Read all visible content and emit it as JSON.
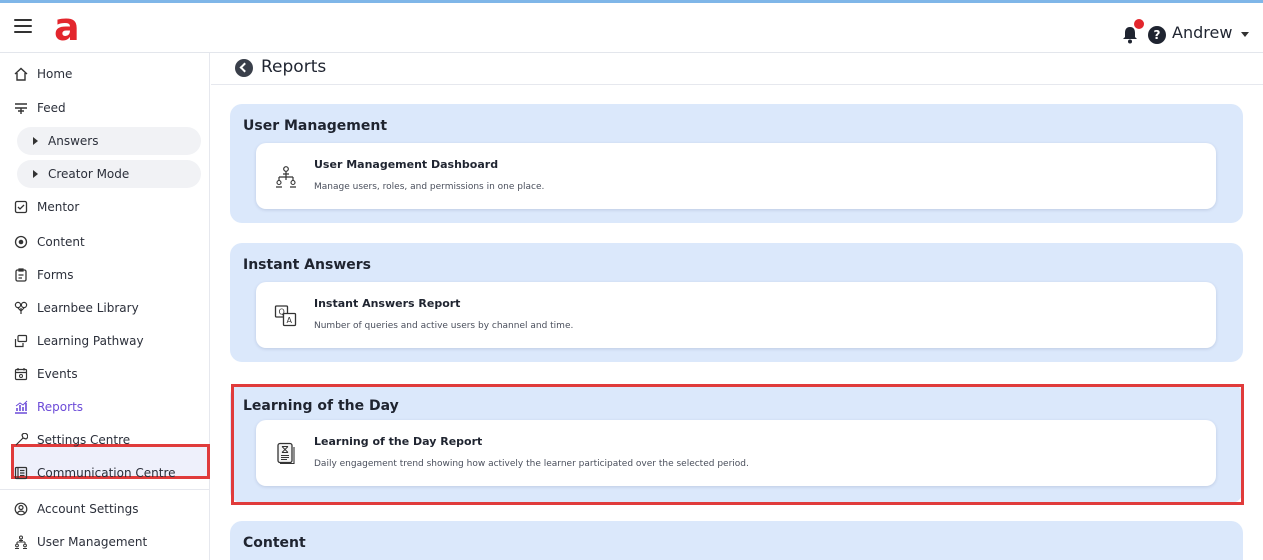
{
  "header": {
    "logo": "a",
    "user_name": "Andrew"
  },
  "sidebar": {
    "items": [
      {
        "label": "Home",
        "icon": "home-icon"
      },
      {
        "label": "Feed",
        "icon": "feed-icon"
      },
      {
        "label": "Answers",
        "sub": true
      },
      {
        "label": "Creator Mode",
        "sub": true
      },
      {
        "label": "Mentor",
        "icon": "mentor-icon"
      },
      {
        "label": "Content",
        "icon": "content-icon"
      },
      {
        "label": "Forms",
        "icon": "forms-icon"
      },
      {
        "label": "Learnbee Library",
        "icon": "library-icon"
      },
      {
        "label": "Learning Pathway",
        "icon": "pathway-icon"
      },
      {
        "label": "Events",
        "icon": "calendar-icon"
      },
      {
        "label": "Reports",
        "icon": "reports-icon",
        "active": true
      },
      {
        "label": "Settings Centre",
        "icon": "settings-icon"
      },
      {
        "label": "Communication Centre",
        "icon": "communication-icon"
      },
      {
        "label": "Account Settings",
        "icon": "account-icon"
      },
      {
        "label": "User Management",
        "icon": "users-icon"
      }
    ]
  },
  "main": {
    "page_title": "Reports",
    "sections": [
      {
        "title": "User Management",
        "card": {
          "title": "User Management Dashboard",
          "desc": "Manage users, roles, and permissions in one place.",
          "icon": "user-network-icon"
        }
      },
      {
        "title": "Instant Answers",
        "card": {
          "title": "Instant Answers Report",
          "desc": "Number of queries and active users by channel and time.",
          "icon": "qa-translate-icon"
        }
      },
      {
        "title": "Learning of the Day",
        "card": {
          "title": "Learning of the Day Report",
          "desc": "Daily engagement trend showing how actively the learner participated over the selected period.",
          "icon": "document-hourglass-icon"
        }
      },
      {
        "title": "Content"
      }
    ]
  },
  "colors": {
    "accent": "#6c4bd8",
    "brand": "#e3262d",
    "section_bg": "#dbe8fb",
    "highlight": "#e03b3b"
  }
}
